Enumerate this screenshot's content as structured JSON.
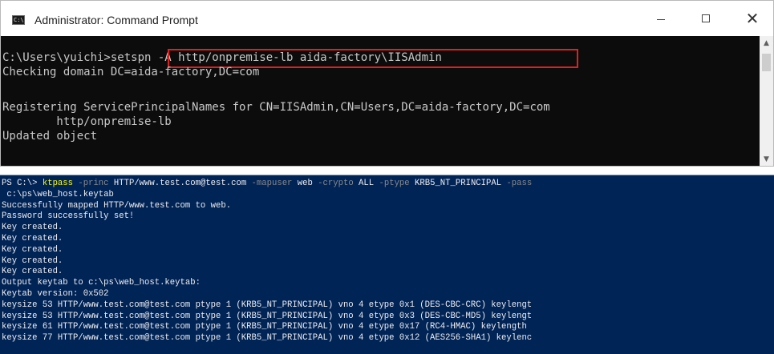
{
  "cmd_window": {
    "title": "Administrator: Command Prompt",
    "icon_label": "C:\\",
    "controls": {
      "minimize": "—",
      "maximize": "☐",
      "close": "✕"
    },
    "console": {
      "prompt": "C:\\Users\\yuichi>",
      "command": "setspn -A http/onpremise-lb aida-factory\\IISAdmin",
      "output": [
        "Checking domain DC=aida-factory,DC=com",
        "",
        "Registering ServicePrincipalNames for CN=IISAdmin,CN=Users,DC=aida-factory,DC=com",
        "        http/onpremise-lb",
        "Updated object"
      ]
    },
    "highlight_color": "#e0201f",
    "scrollbar": {
      "up": "▲",
      "down": "▼"
    }
  },
  "ps_panel": {
    "prompt": "PS C:\\> ",
    "command": {
      "name": "ktpass",
      "tokens": [
        {
          "t": "-princ",
          "kind": "param"
        },
        {
          "t": "HTTP/www.test.com@test.com",
          "kind": "value"
        },
        {
          "t": "-mapuser",
          "kind": "param"
        },
        {
          "t": "web",
          "kind": "value"
        },
        {
          "t": "-crypto",
          "kind": "param"
        },
        {
          "t": "ALL",
          "kind": "value"
        },
        {
          "t": "-ptype",
          "kind": "param"
        },
        {
          "t": "KRB5_NT_PRINCIPAL",
          "kind": "value"
        },
        {
          "t": "-pass",
          "kind": "param"
        }
      ],
      "continuation": " c:\\ps\\web_host.keytab"
    },
    "output": [
      "Successfully mapped HTTP/www.test.com to web.",
      "Password successfully set!",
      "Key created.",
      "Key created.",
      "Key created.",
      "Key created.",
      "Key created.",
      "Output keytab to c:\\ps\\web_host.keytab:",
      "Keytab version: 0x502",
      "keysize 53 HTTP/www.test.com@test.com ptype 1 (KRB5_NT_PRINCIPAL) vno 4 etype 0x1 (DES-CBC-CRC) keylengt",
      "keysize 53 HTTP/www.test.com@test.com ptype 1 (KRB5_NT_PRINCIPAL) vno 4 etype 0x3 (DES-CBC-MD5) keylengt",
      "keysize 61 HTTP/www.test.com@test.com ptype 1 (KRB5_NT_PRINCIPAL) vno 4 etype 0x17 (RC4-HMAC) keylength",
      "keysize 77 HTTP/www.test.com@test.com ptype 1 (KRB5_NT_PRINCIPAL) vno 4 etype 0x12 (AES256-SHA1) keylenc"
    ],
    "colors": {
      "background": "#012456",
      "command": "#ffff00",
      "parameter": "#8a8a8a",
      "text": "#eeedf0"
    }
  }
}
